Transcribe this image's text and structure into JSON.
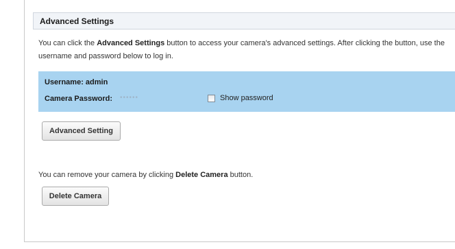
{
  "section": {
    "title": "Advanced Settings"
  },
  "description": {
    "part1": "You can click the ",
    "bold": "Advanced Settings",
    "part2": " button to access your camera's advanced settings. After clicking the button, use the username and password below to log in."
  },
  "credentials": {
    "username_label": "Username: admin",
    "password_label": "Camera Password:",
    "password_mask": "••••••",
    "show_password_label": "Show password",
    "show_password_checked": false
  },
  "buttons": {
    "advanced_setting": "Advanced Setting",
    "delete_camera": "Delete Camera"
  },
  "remove": {
    "part1": "You can remove your camera by clicking ",
    "bold": "Delete Camera",
    "part2": " button."
  },
  "colors": {
    "credentials_background": "#a8d3f0",
    "header_background": "#f1f4f8"
  }
}
